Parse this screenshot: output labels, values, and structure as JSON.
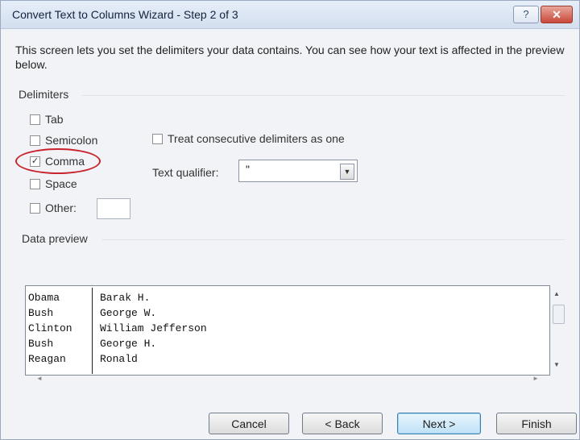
{
  "window": {
    "title": "Convert Text to Columns Wizard - Step 2 of 3",
    "help_label": "?",
    "close_label": "✕"
  },
  "description": "This screen lets you set the delimiters your data contains. You can see how your text is affected in the preview below.",
  "delimiters": {
    "label": "Delimiters",
    "items": [
      {
        "label": "Tab",
        "checked": false
      },
      {
        "label": "Semicolon",
        "checked": false
      },
      {
        "label": "Comma",
        "checked": true
      },
      {
        "label": "Space",
        "checked": false
      },
      {
        "label": "Other:",
        "checked": false
      }
    ],
    "other_value": "",
    "check_mark": "✓"
  },
  "consecutive": {
    "label": "Treat consecutive delimiters as one",
    "checked": false
  },
  "text_qualifier": {
    "label": "Text qualifier:",
    "value": "\""
  },
  "preview": {
    "label": "Data preview",
    "rows": [
      [
        "Obama",
        "Barak H."
      ],
      [
        "Bush",
        "George W."
      ],
      [
        "Clinton",
        "William Jefferson"
      ],
      [
        "Bush",
        "George H."
      ],
      [
        "Reagan",
        "Ronald"
      ]
    ]
  },
  "buttons": {
    "cancel": "Cancel",
    "back": "< Back",
    "next": "Next >",
    "finish": "Finish"
  },
  "colors": {
    "highlight": "#c8232f",
    "title_bar": "#d3deee",
    "default_button": "#bfe1f7"
  },
  "icons": {
    "scroll_up": "▲",
    "scroll_down": "▼",
    "scroll_left": "◄",
    "scroll_right": "►",
    "dropdown": "▼"
  }
}
